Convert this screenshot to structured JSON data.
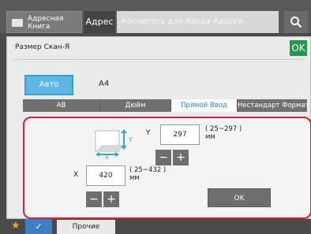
{
  "topbar": {
    "address_book_label": "Адресная Книга",
    "address_tab_label": "Адрес",
    "address_placeholder": "Коснитесь для Ввода Адреса"
  },
  "dialog": {
    "title": "Размер Скан-Я",
    "ok_top_label": "OK",
    "auto_label": "Авто",
    "auto_size": "A4",
    "tabs": [
      {
        "label": "AB",
        "active": false
      },
      {
        "label": "Дюйм",
        "active": false
      },
      {
        "label": "Прямой Ввод",
        "active": true
      },
      {
        "label": "Нестандарт Формат",
        "active": false
      }
    ],
    "direct_input": {
      "y_label": "Y",
      "y_value": "297",
      "y_range": "( 25~297 )",
      "y_unit": "мм",
      "x_label": "X",
      "x_value": "420",
      "x_range": "( 25~432 )",
      "x_unit": "мм",
      "minus_symbol": "−",
      "plus_symbol": "+",
      "ok_label": "OK"
    }
  },
  "bottombar": {
    "other_label": "Прочие"
  },
  "colors": {
    "accent_blue": "#5db7e6",
    "ok_green": "#1f9a4b",
    "highlight_red": "#d91e3a",
    "star_orange": "#f2a81f"
  },
  "icons": [
    "address-book-icon",
    "search-icon",
    "paper-size-icon",
    "star-icon",
    "checkmark-icon"
  ]
}
